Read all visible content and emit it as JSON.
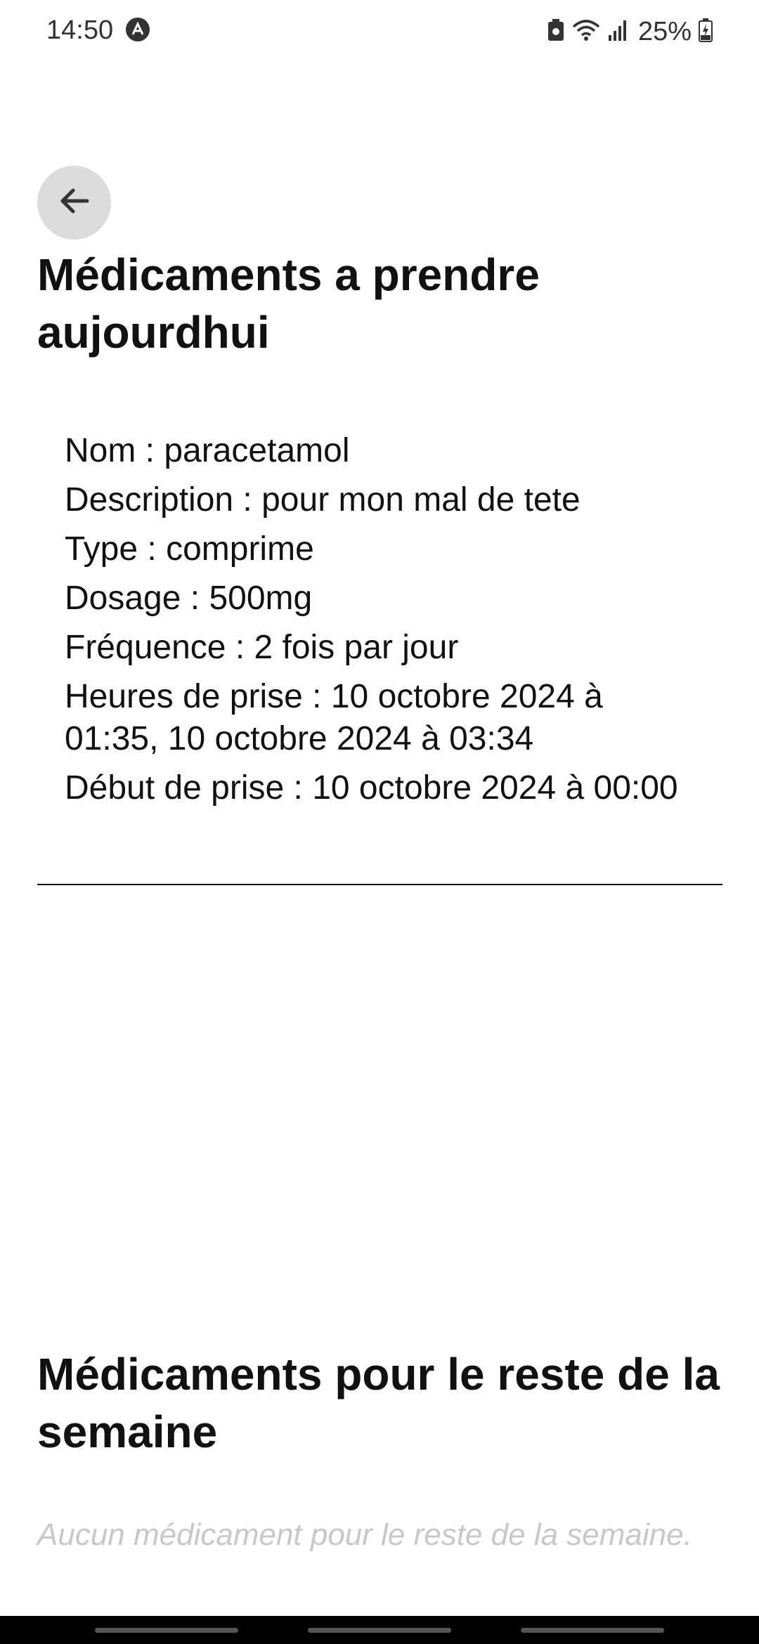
{
  "status_bar": {
    "time": "14:50",
    "battery": "25%",
    "icons": [
      "app-notification-icon",
      "battery-saver-icon",
      "wifi-icon",
      "signal-icon",
      "battery-charging-icon"
    ]
  },
  "header": {
    "back_icon": "arrow-left-icon"
  },
  "today": {
    "title": "Médicaments a prendre aujourdhui",
    "medication": {
      "name": "Nom : paracetamol",
      "description": "Description : pour mon mal de tete",
      "type": "Type : comprime",
      "dosage": "Dosage : 500mg",
      "frequency": "Fréquence : 2 fois par jour",
      "hours": "Heures de prise : 10 octobre 2024 à 01:35, 10 octobre 2024 à 03:34",
      "start": "Début de prise : 10 octobre 2024 à 00:00"
    }
  },
  "week": {
    "title": "Médicaments pour le reste de la semaine",
    "empty_message": "Aucun médicament pour le reste de la semaine."
  },
  "colors": {
    "back_button_bg": "#dcdcdc",
    "text": "#111111",
    "placeholder": "#c8c8c8",
    "nav_bar": "#000000"
  }
}
